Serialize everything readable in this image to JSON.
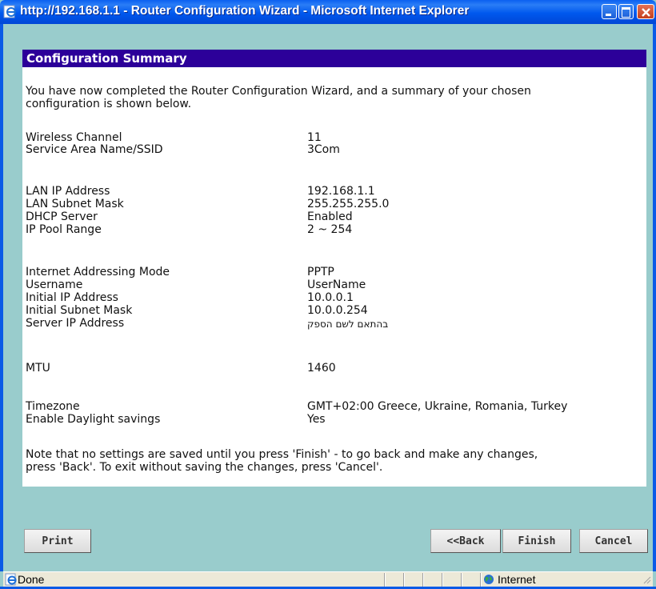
{
  "window": {
    "title": "http://192.168.1.1 - Router Configuration Wizard - Microsoft Internet Explorer"
  },
  "section": {
    "title": "Configuration Summary"
  },
  "intro": [
    "You have now completed the Router Configuration Wizard, and a summary of your chosen",
    "configuration is shown below."
  ],
  "settings": {
    "wireless_channel": {
      "label": "Wireless Channel",
      "value": "11"
    },
    "ssid": {
      "label": "Service Area Name/SSID",
      "value": "3Com"
    },
    "lan_ip": {
      "label": "LAN IP Address",
      "value": "192.168.1.1"
    },
    "lan_mask": {
      "label": "LAN Subnet Mask",
      "value": "255.255.255.0"
    },
    "dhcp": {
      "label": "DHCP Server",
      "value": "Enabled"
    },
    "pool": {
      "label": "IP Pool Range",
      "value": "2 ~ 254"
    },
    "mode": {
      "label": "Internet Addressing Mode",
      "value": "PPTP"
    },
    "username": {
      "label": "Username",
      "value": "UserName"
    },
    "init_ip": {
      "label": "Initial IP Address",
      "value": "10.0.0.1"
    },
    "init_mask": {
      "label": "Initial Subnet Mask",
      "value": "10.0.0.254"
    },
    "server_ip": {
      "label": "Server IP Address",
      "value": "בהתאם לשם הספק"
    },
    "mtu": {
      "label": "MTU",
      "value": "1460"
    },
    "timezone": {
      "label": "Timezone",
      "value": "GMT+02:00 Greece, Ukraine, Romania, Turkey"
    },
    "dst": {
      "label": "Enable Daylight savings",
      "value": "Yes"
    }
  },
  "note": [
    "Note that no settings are saved until you press 'Finish' - to go back and make any changes,",
    "press 'Back'. To exit without saving the changes, press 'Cancel'."
  ],
  "buttons": {
    "print": "Print",
    "back": "<<Back",
    "finish": "Finish",
    "cancel": "Cancel"
  },
  "statusbar": {
    "text": "Done",
    "zone": "Internet"
  },
  "colors": {
    "titlebar": "#0058ee",
    "section_header": "#2c0099",
    "page_background": "#99cccc",
    "panel": "#ffffff"
  },
  "icons": [
    "ie-page-icon",
    "minimize-icon",
    "maximize-icon",
    "close-icon",
    "globe-icon",
    "resize-grip-icon"
  ]
}
